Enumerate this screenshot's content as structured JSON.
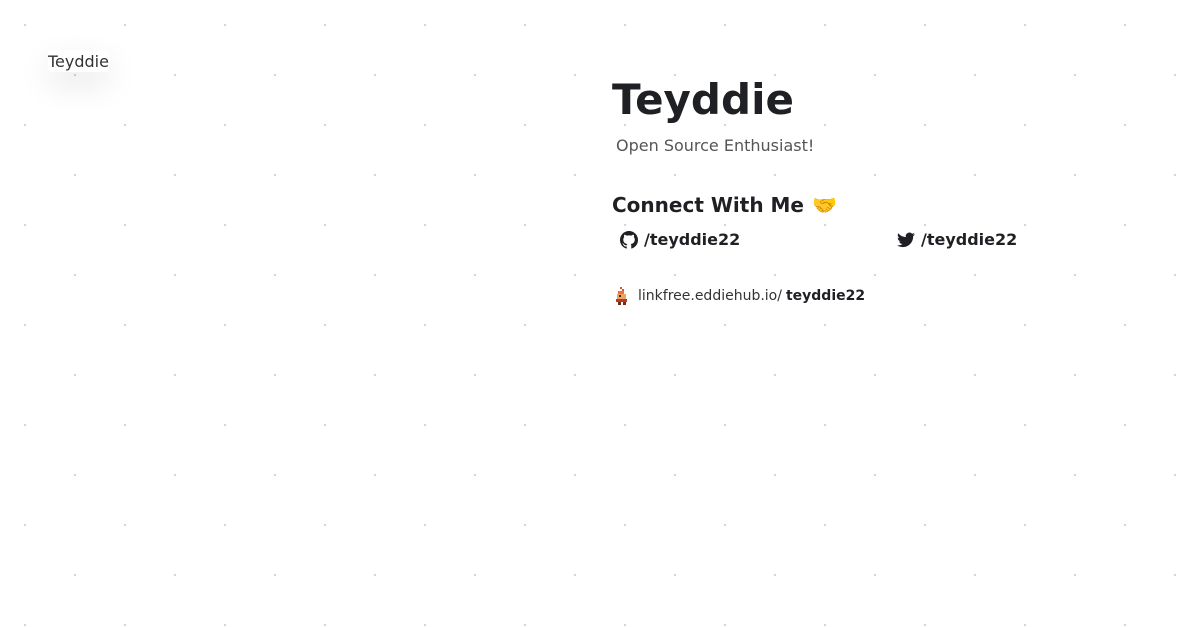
{
  "profile": {
    "avatar_alt": "Teyddie",
    "name": "Teyddie",
    "tagline": "Open Source Enthusiast!"
  },
  "connect": {
    "heading": "Connect With Me",
    "heading_emoji": "🤝",
    "github": {
      "icon": "github-icon",
      "handle": "/teyddie22"
    },
    "twitter": {
      "icon": "twitter-icon",
      "handle": "/teyddie22"
    }
  },
  "linkfree": {
    "icon": "linkfree-icon",
    "domain": "linkfree.eddiehub.io/",
    "username": "teyddie22"
  }
}
